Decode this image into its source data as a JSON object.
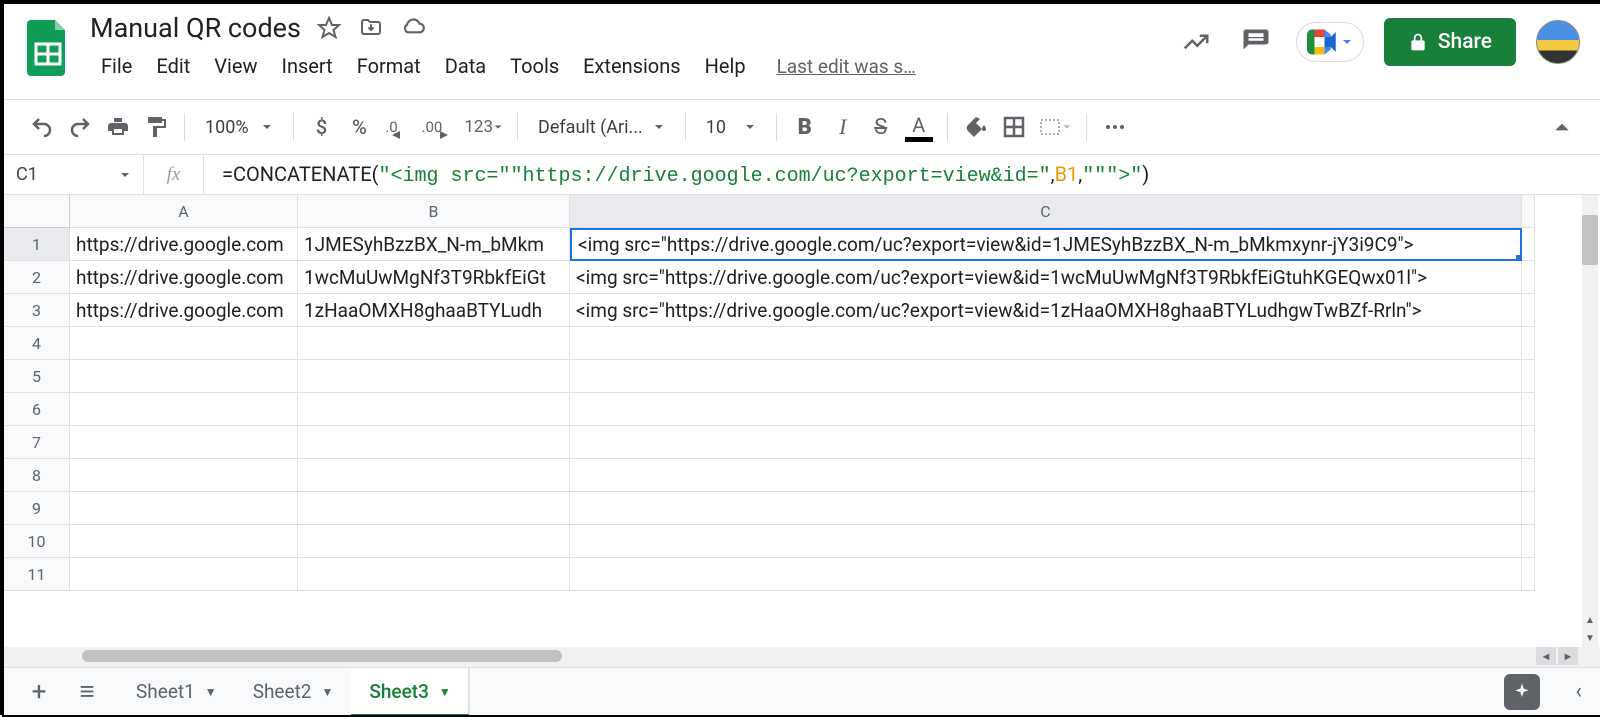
{
  "doc": {
    "title": "Manual QR codes",
    "last_edit": "Last edit was s…"
  },
  "menu": [
    "File",
    "Edit",
    "View",
    "Insert",
    "Format",
    "Data",
    "Tools",
    "Extensions",
    "Help"
  ],
  "share": "Share",
  "toolbar": {
    "zoom": "100%",
    "font_name": "Default (Ari...",
    "font_size": "10"
  },
  "name_box": "C1",
  "formula": {
    "prefix": "=CONCATENATE(",
    "str1": "\"<img src=\"\"https://drive.google.com/uc?export=view&id=\"",
    "ref": "B1",
    "str2": "\"\"\">\"",
    "suffix": ")"
  },
  "columns": [
    "A",
    "B",
    "C"
  ],
  "rows": [
    {
      "n": 1,
      "A": "https://drive.google.com",
      "B": "1JMESyhBzzBX_N-m_bMkm",
      "C": "<img src=\"https://drive.google.com/uc?export=view&id=1JMESyhBzzBX_N-m_bMkmxynr-jY3i9C9\">"
    },
    {
      "n": 2,
      "A": "https://drive.google.com",
      "B": "1wcMuUwMgNf3T9RbkfEiGt",
      "C": "<img src=\"https://drive.google.com/uc?export=view&id=1wcMuUwMgNf3T9RbkfEiGtuhKGEQwx01l\">"
    },
    {
      "n": 3,
      "A": "https://drive.google.com",
      "B": "1zHaaOMXH8ghaaBTYLudh",
      "C": "<img src=\"https://drive.google.com/uc?export=view&id=1zHaaOMXH8ghaaBTYLudhgwTwBZf-Rrln\">"
    },
    {
      "n": 4,
      "A": "",
      "B": "",
      "C": ""
    },
    {
      "n": 5,
      "A": "",
      "B": "",
      "C": ""
    },
    {
      "n": 6,
      "A": "",
      "B": "",
      "C": ""
    },
    {
      "n": 7,
      "A": "",
      "B": "",
      "C": ""
    },
    {
      "n": 8,
      "A": "",
      "B": "",
      "C": ""
    },
    {
      "n": 9,
      "A": "",
      "B": "",
      "C": ""
    },
    {
      "n": 10,
      "A": "",
      "B": "",
      "C": ""
    },
    {
      "n": 11,
      "A": "",
      "B": "",
      "C": ""
    }
  ],
  "selected_cell": "C1",
  "sheets": [
    {
      "name": "Sheet1",
      "active": false
    },
    {
      "name": "Sheet2",
      "active": false
    },
    {
      "name": "Sheet3",
      "active": true
    }
  ]
}
